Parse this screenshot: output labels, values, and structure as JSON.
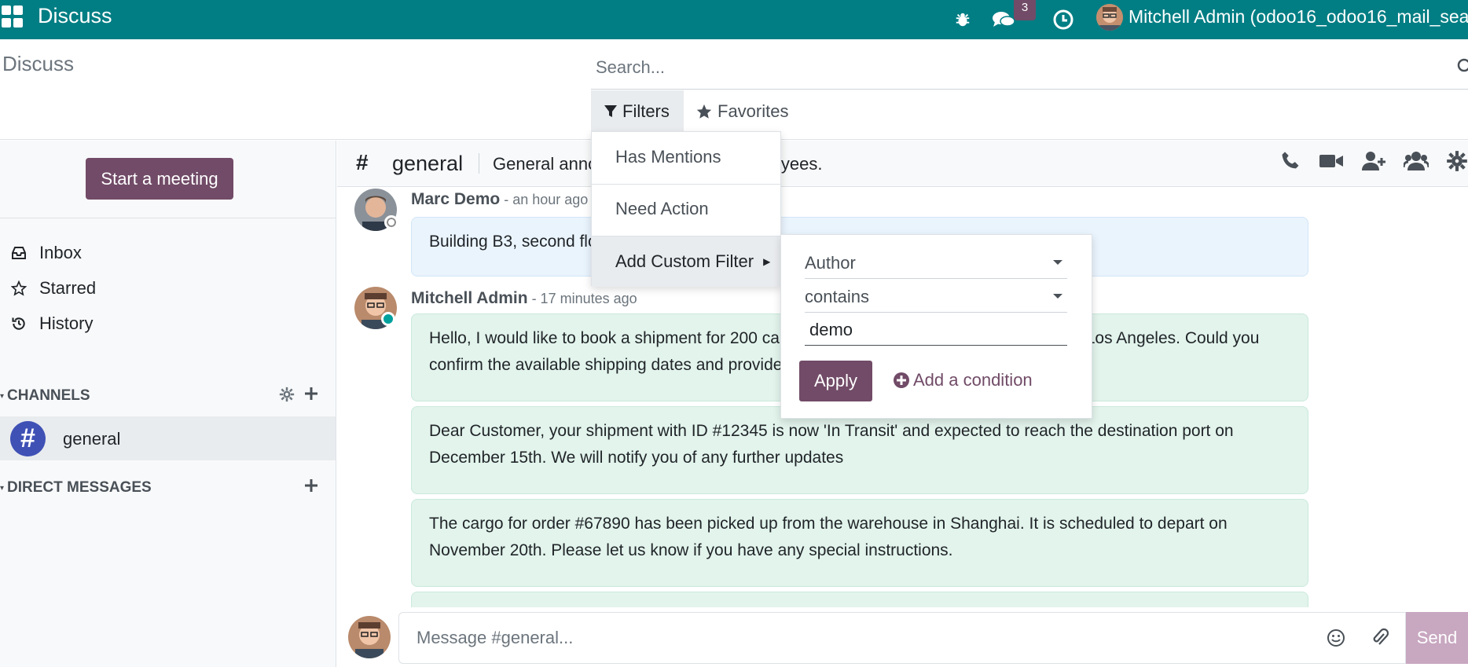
{
  "topbar": {
    "app_title": "Discuss",
    "chat_badge": "3",
    "user_name": "Mitchell Admin (odoo16_odoo16_mail_sear"
  },
  "control": {
    "breadcrumb": "Discuss",
    "search_placeholder": "Search...",
    "filters_label": "Filters",
    "favorites_label": "Favorites"
  },
  "sidebar": {
    "start_meeting": "Start a meeting",
    "mailboxes": [
      {
        "label": "Inbox",
        "icon": "inbox-icon"
      },
      {
        "label": "Starred",
        "icon": "star-icon"
      },
      {
        "label": "History",
        "icon": "history-icon"
      }
    ],
    "channels_header": "CHANNELS",
    "channel": "general",
    "dm_header": "DIRECT MESSAGES"
  },
  "thread": {
    "name": "general",
    "description": "General announcements for all employees."
  },
  "messages": [
    {
      "author": "Marc Demo",
      "time": " - an hour ago",
      "text": "Building B3, second floor"
    },
    {
      "author": "Mitchell Admin",
      "time": " - 17 minutes ago",
      "text": "Hello, I would like to book a shipment for 200 cartons of electronics from New York City to Los Angeles. Could you confirm the available shipping dates and provide a price estimate, please?"
    },
    {
      "text": "Dear Customer, your shipment with ID #12345 is now 'In Transit' and expected to reach the destination port on December 15th. We will notify you of any further updates"
    },
    {
      "text": "The cargo for order #67890 has been picked up from the warehouse in Shanghai. It is scheduled to depart on November 20th. Please let us know if you have any special instructions."
    }
  ],
  "composer": {
    "placeholder": "Message #general...",
    "send_label": "Send"
  },
  "filters_dropdown": {
    "items": [
      "Has Mentions",
      "Need Action",
      "Add Custom Filter"
    ]
  },
  "custom_filter": {
    "field": "Author",
    "operator": "contains",
    "value": "demo",
    "apply_label": "Apply",
    "add_condition_label": "Add a condition"
  },
  "colors": {
    "topbar": "#017e84",
    "brand": "#714b67",
    "message_bg": "#e2f4ec"
  }
}
